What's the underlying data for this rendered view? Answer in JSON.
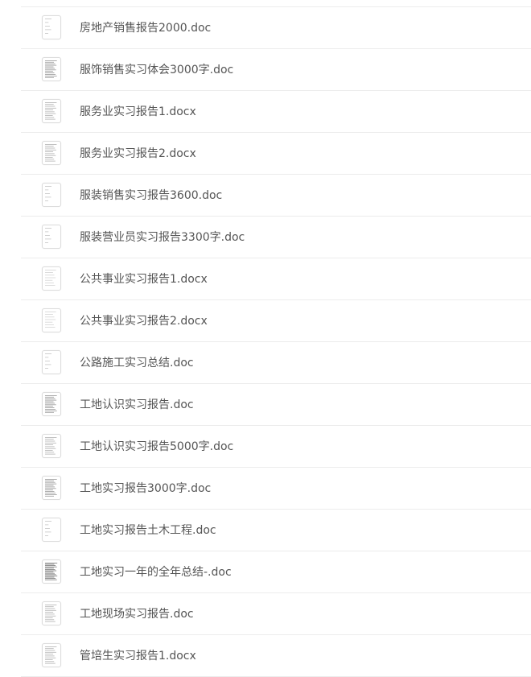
{
  "files": [
    {
      "name": "房地产销售报告2000.doc",
      "thumb_style": "sparse"
    },
    {
      "name": "服饰销售实习体会3000字.doc",
      "thumb_style": "dense"
    },
    {
      "name": "服务业实习报告1.docx",
      "thumb_style": "medium"
    },
    {
      "name": "服务业实习报告2.docx",
      "thumb_style": "medium"
    },
    {
      "name": "服装销售实习报告3600.doc",
      "thumb_style": "sparse"
    },
    {
      "name": "服装营业员实习报告3300字.doc",
      "thumb_style": "sparse"
    },
    {
      "name": "公共事业实习报告1.docx",
      "thumb_style": "light"
    },
    {
      "name": "公共事业实习报告2.docx",
      "thumb_style": "light"
    },
    {
      "name": "公路施工实习总结.doc",
      "thumb_style": "sparse"
    },
    {
      "name": "工地认识实习报告.doc",
      "thumb_style": "dense"
    },
    {
      "name": "工地认识实习报告5000字.doc",
      "thumb_style": "medium"
    },
    {
      "name": "工地实习报告3000字.doc",
      "thumb_style": "dense"
    },
    {
      "name": "工地实习报告土木工程.doc",
      "thumb_style": "sparse"
    },
    {
      "name": "工地实习一年的全年总结-.doc",
      "thumb_style": "heavy"
    },
    {
      "name": "工地现场实习报告.doc",
      "thumb_style": "medium"
    },
    {
      "name": "管培生实习报告1.docx",
      "thumb_style": "medium"
    }
  ]
}
